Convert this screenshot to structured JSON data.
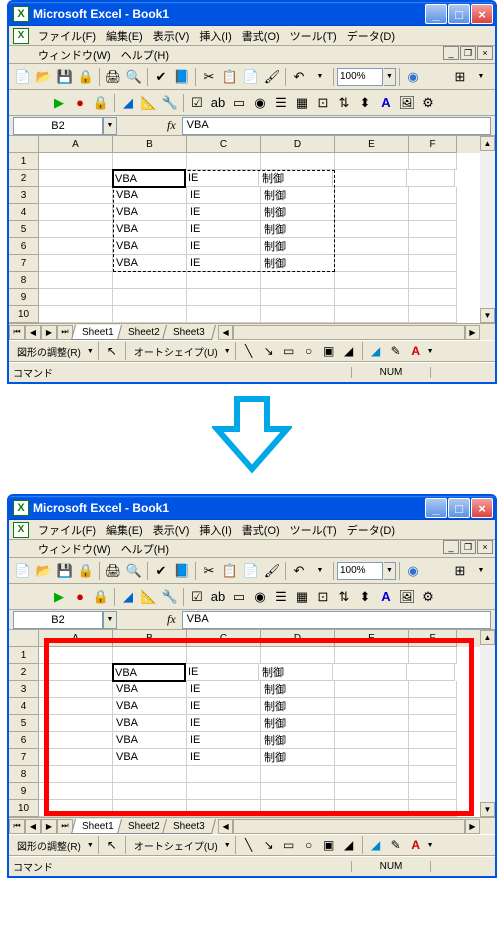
{
  "app": {
    "title": "Microsoft Excel - Book1"
  },
  "menus": {
    "file": "ファイル(F)",
    "edit": "編集(E)",
    "view": "表示(V)",
    "insert": "挿入(I)",
    "format": "書式(O)",
    "tools": "ツール(T)",
    "data": "データ(D)",
    "window": "ウィンドウ(W)",
    "help": "ヘルプ(H)"
  },
  "toolbar": {
    "zoom": "100%"
  },
  "namebox": "B2",
  "formula": "VBA",
  "columns": [
    "A",
    "B",
    "C",
    "D",
    "E",
    "F"
  ],
  "rows": [
    {
      "n": "1",
      "cells": [
        "",
        "",
        "",
        "",
        "",
        ""
      ]
    },
    {
      "n": "2",
      "cells": [
        "",
        "VBA",
        "IE",
        "制御",
        "",
        ""
      ]
    },
    {
      "n": "3",
      "cells": [
        "",
        "VBA",
        "IE",
        "制御",
        "",
        ""
      ]
    },
    {
      "n": "4",
      "cells": [
        "",
        "VBA",
        "IE",
        "制御",
        "",
        ""
      ]
    },
    {
      "n": "5",
      "cells": [
        "",
        "VBA",
        "IE",
        "制御",
        "",
        ""
      ]
    },
    {
      "n": "6",
      "cells": [
        "",
        "VBA",
        "IE",
        "制御",
        "",
        ""
      ]
    },
    {
      "n": "7",
      "cells": [
        "",
        "VBA",
        "IE",
        "制御",
        "",
        ""
      ]
    },
    {
      "n": "8",
      "cells": [
        "",
        "",
        "",
        "",
        "",
        ""
      ]
    },
    {
      "n": "9",
      "cells": [
        "",
        "",
        "",
        "",
        "",
        ""
      ]
    },
    {
      "n": "10",
      "cells": [
        "",
        "",
        "",
        "",
        "",
        ""
      ]
    }
  ],
  "sheets": {
    "s1": "Sheet1",
    "s2": "Sheet2",
    "s3": "Sheet3"
  },
  "draw": {
    "adjust": "図形の調整(R)",
    "autoshape": "オートシェイプ(U)"
  },
  "status": {
    "mode": "コマンド",
    "num": "NUM"
  }
}
